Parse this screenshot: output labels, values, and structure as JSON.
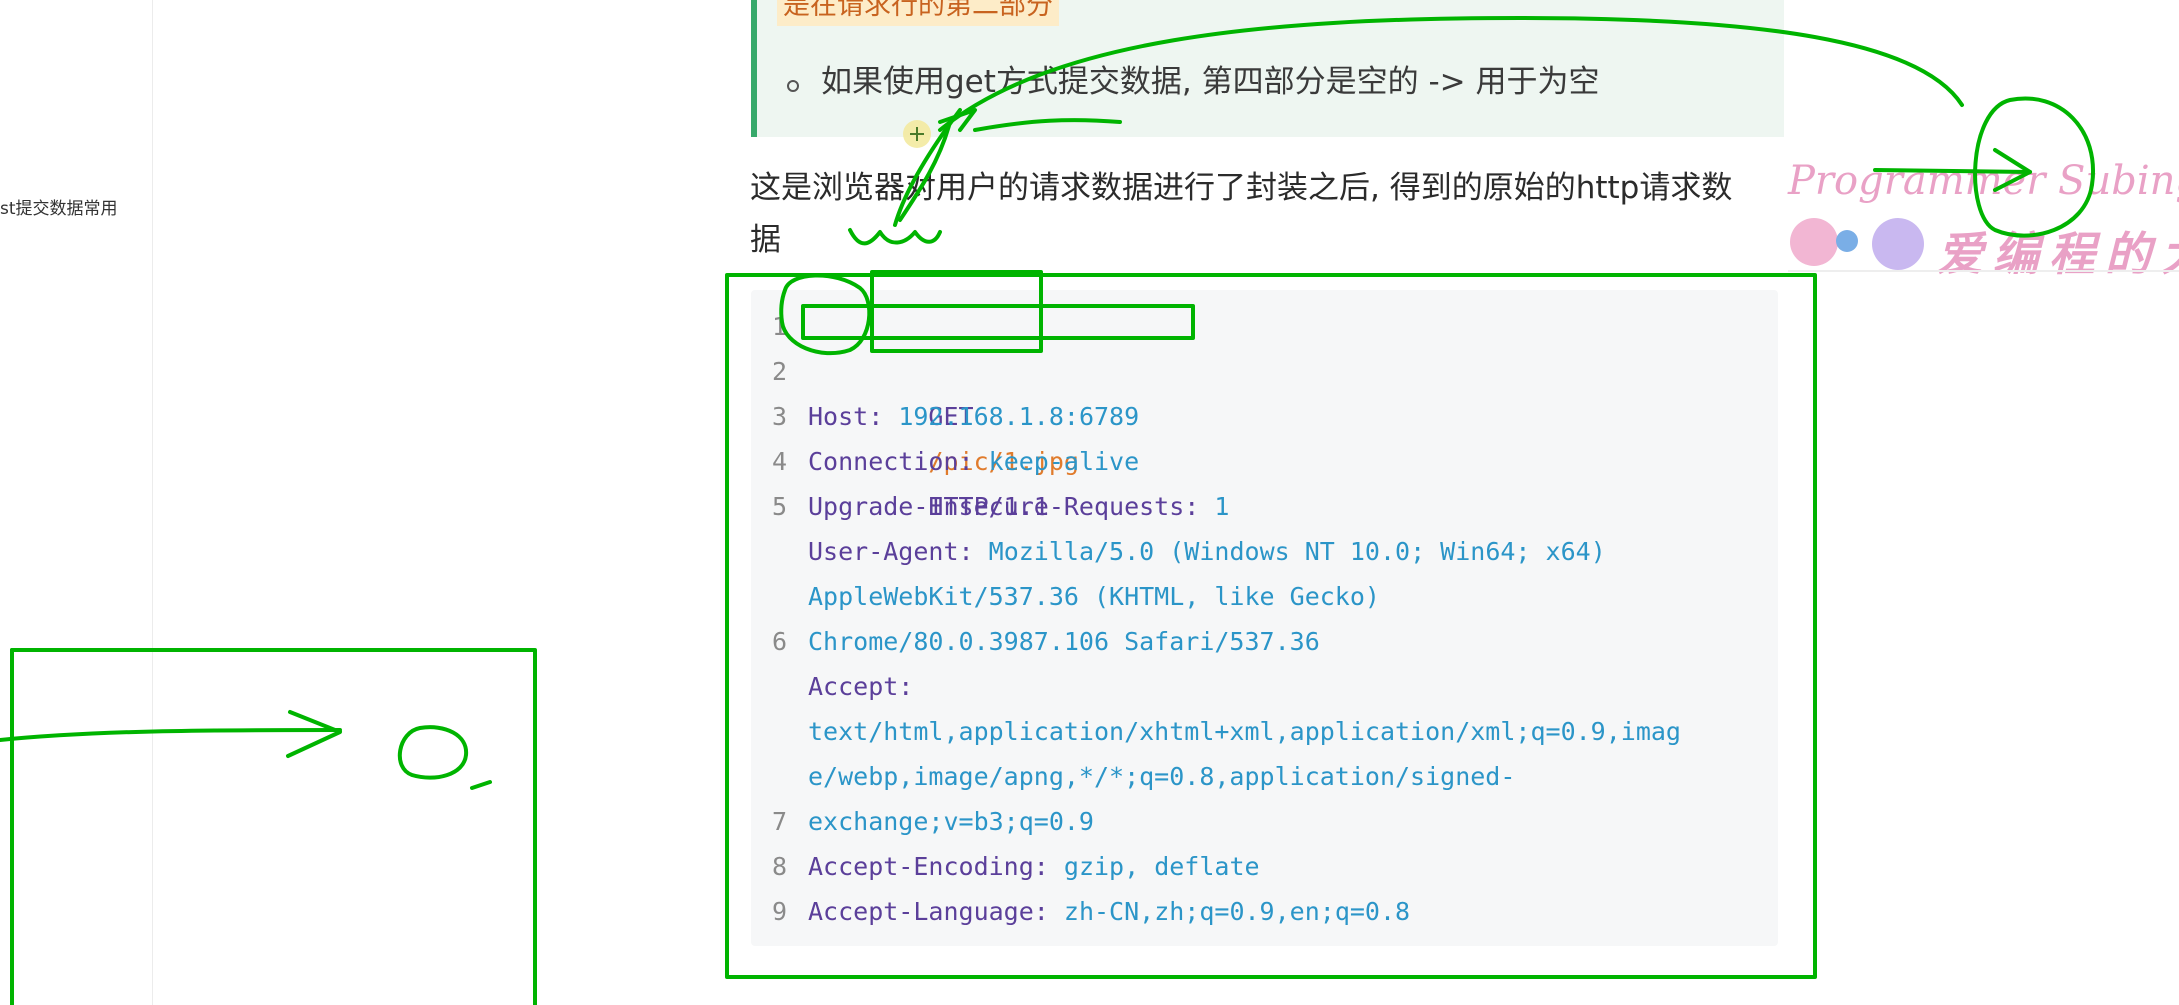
{
  "sidebar": {
    "visible_item": "st提交数据常用"
  },
  "note": {
    "highlight": "是在请求行的第二部分",
    "bullet": "如果使用get方式提交数据, 第四部分是空的 -> 用于为空"
  },
  "intro": "这是浏览器对用户的请求数据进行了封装之后, 得到的原始的http请求数据",
  "code": {
    "line_numbers": [
      "1",
      "2",
      "3",
      "4",
      "5",
      "6",
      "7",
      "8",
      "9"
    ],
    "l1_method": "GET",
    "l1_path": "/pic/1.jpg",
    "l1_version": "HTTP/1.1",
    "l2_key": "Host:",
    "l2_val": "192.168.1.8:6789",
    "l3_key": "Connection:",
    "l3_val": "keep-alive",
    "l4_key": "Upgrade-Insecure-Requests:",
    "l4_val": "1",
    "l5_key": "User-Agent:",
    "l5_val_a": "Mozilla/5.0 (Windows NT 10.0; Win64; x64)",
    "l5_val_b": "AppleWebKit/537.36 (KHTML, like Gecko)",
    "l5_val_c": "Chrome/80.0.3987.106 Safari/537.36",
    "l6_key": "Accept:",
    "l6_val_a": "text/html,application/xhtml+xml,application/xml;q=0.9,imag",
    "l6_val_b": "e/webp,image/apng,*/*;q=0.8,application/signed-",
    "l6_val_c": "exchange;v=b3;q=0.9",
    "l7_key": "Accept-Encoding:",
    "l7_val": "gzip, deflate",
    "l8_key": "Accept-Language:",
    "l8_val": "zh-CN,zh;q=0.9,en;q=0.8"
  },
  "watermark": {
    "latin": "Programmer Subingwe",
    "chinese": "爱编程的大",
    "colors": {
      "pink": "#e9a1c6",
      "violet": "#c9b8f0"
    }
  },
  "annotation_color": "#00b400"
}
